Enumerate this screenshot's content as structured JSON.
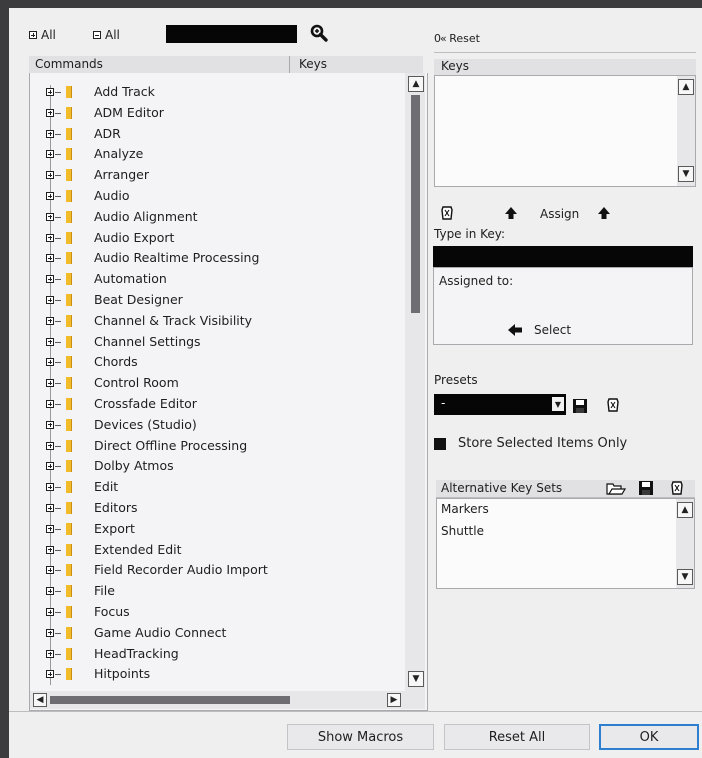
{
  "toolbar": {
    "expand_all_label": "All",
    "collapse_all_label": "All",
    "search_value": ""
  },
  "commands_panel": {
    "col_commands": "Commands",
    "col_keys": "Keys",
    "items": [
      "Add Track",
      "ADM Editor",
      "ADR",
      "Analyze",
      "Arranger",
      "Audio",
      "Audio Alignment",
      "Audio Export",
      "Audio Realtime Processing",
      "Automation",
      "Beat Designer",
      "Channel & Track Visibility",
      "Channel Settings",
      "Chords",
      "Control Room",
      "Crossfade Editor",
      "Devices (Studio)",
      "Direct Offline Processing",
      "Dolby Atmos",
      "Edit",
      "Editors",
      "Export",
      "Extended Edit",
      "Field Recorder Audio Import",
      "File",
      "Focus",
      "Game Audio Connect",
      "HeadTracking",
      "Hitpoints"
    ]
  },
  "right_panel": {
    "reset_label": "Reset",
    "keys_header": "Keys",
    "assign_label": "Assign",
    "type_in_key_label": "Type in Key:",
    "type_in_key_value": "",
    "assigned_to_label": "Assigned to:",
    "select_label": "Select",
    "presets_label": "Presets",
    "preset_value": "-",
    "store_selected_label": "Store Selected Items Only",
    "store_selected_checked": false,
    "alt_key_sets_header": "Alternative Key Sets",
    "alt_key_sets": [
      "Markers",
      "Shuttle"
    ]
  },
  "footer": {
    "show_macros_label": "Show Macros",
    "reset_all_label": "Reset All",
    "ok_label": "OK"
  },
  "colors": {
    "dialog_bg": "#efeff0",
    "folder": "#f2bb29",
    "ok_border": "#2f7fd0"
  }
}
